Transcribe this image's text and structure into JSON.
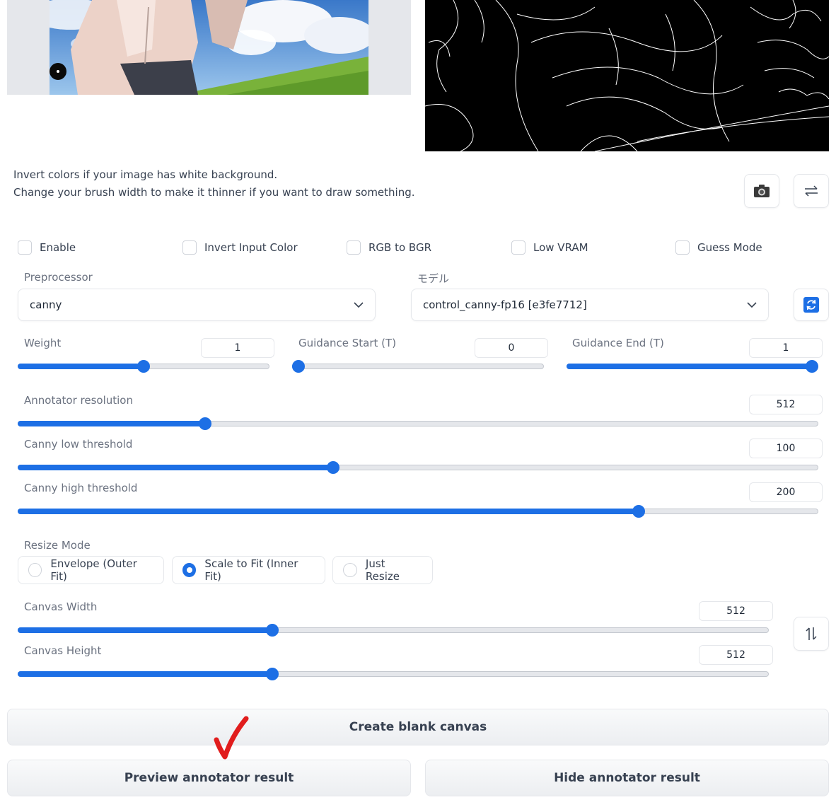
{
  "help": {
    "line1": "Invert colors if your image has white background.",
    "line2": "Change your brush width to make it thinner if you want to draw something."
  },
  "toolbar": {
    "camera_icon": "camera-icon",
    "swap_icon": "swap-arrows-icon",
    "refresh_icon": "refresh-icon",
    "swap_dims_icon": "swap-vertical-icon"
  },
  "checkboxes": [
    {
      "label": "Enable",
      "checked": false
    },
    {
      "label": "Invert Input Color",
      "checked": false
    },
    {
      "label": "RGB to BGR",
      "checked": false
    },
    {
      "label": "Low VRAM",
      "checked": false
    },
    {
      "label": "Guess Mode",
      "checked": false
    }
  ],
  "preprocessor": {
    "label": "Preprocessor",
    "value": "canny"
  },
  "model": {
    "label": "モデル",
    "value": "control_canny-fp16 [e3fe7712]"
  },
  "sliders": {
    "weight": {
      "label": "Weight",
      "value": "1",
      "fraction": 0.5
    },
    "guidance_start": {
      "label": "Guidance Start (T)",
      "value": "0",
      "fraction": 0.0
    },
    "guidance_end": {
      "label": "Guidance End (T)",
      "value": "1",
      "fraction": 1.0
    },
    "annotator_resolution": {
      "label": "Annotator resolution",
      "value": "512",
      "fraction": 0.23
    },
    "canny_low": {
      "label": "Canny low threshold",
      "value": "100",
      "fraction": 0.392
    },
    "canny_high": {
      "label": "Canny high threshold",
      "value": "200",
      "fraction": 0.78
    },
    "canvas_width": {
      "label": "Canvas Width",
      "value": "512",
      "fraction": 0.336
    },
    "canvas_height": {
      "label": "Canvas Height",
      "value": "512",
      "fraction": 0.336
    }
  },
  "resize_mode": {
    "label": "Resize Mode",
    "options": [
      {
        "label": "Envelope (Outer Fit)",
        "selected": false
      },
      {
        "label": "Scale to Fit (Inner Fit)",
        "selected": true
      },
      {
        "label": "Just Resize",
        "selected": false
      }
    ]
  },
  "buttons": {
    "create_canvas": "Create blank canvas",
    "preview": "Preview annotator result",
    "hide": "Hide annotator result"
  },
  "colors": {
    "accent": "#1d6fe5",
    "annotation": "#e11d1d"
  }
}
